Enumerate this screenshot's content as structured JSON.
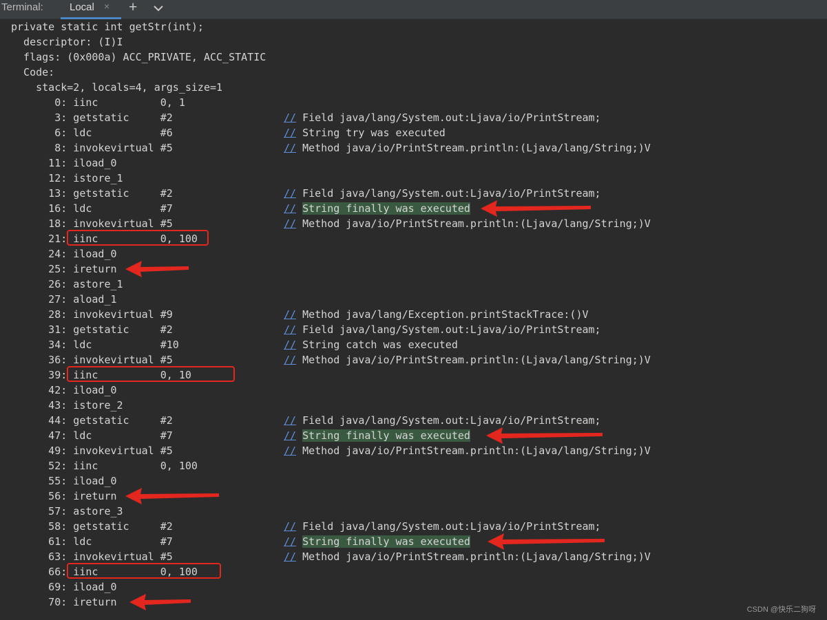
{
  "tabbar": {
    "label": "Terminal:",
    "tab_label": "Local",
    "close_glyph": "×",
    "new_tab_glyph": "+",
    "icons": [
      "close-icon",
      "plus-icon",
      "chevron-down-icon"
    ]
  },
  "header_lines": [
    "private static int getStr(int);",
    "  descriptor: (I)I",
    "  flags: (0x000a) ACC_PRIVATE, ACC_STATIC",
    "  Code:",
    "    stack=2, locals=4, args_size=1"
  ],
  "instructions": [
    {
      "code": "       0: iinc          0, 1",
      "comment": "",
      "highlight": false
    },
    {
      "code": "       3: getstatic     #2",
      "comment": "Field java/lang/System.out:Ljava/io/PrintStream;",
      "highlight": false
    },
    {
      "code": "       6: ldc           #6",
      "comment": "String try was executed",
      "highlight": false
    },
    {
      "code": "       8: invokevirtual #5",
      "comment": "Method java/io/PrintStream.println:(Ljava/lang/String;)V",
      "highlight": false
    },
    {
      "code": "      11: iload_0",
      "comment": "",
      "highlight": false
    },
    {
      "code": "      12: istore_1",
      "comment": "",
      "highlight": false
    },
    {
      "code": "      13: getstatic     #2",
      "comment": "Field java/lang/System.out:Ljava/io/PrintStream;",
      "highlight": false
    },
    {
      "code": "      16: ldc           #7",
      "comment": "String finally was executed",
      "highlight": true
    },
    {
      "code": "      18: invokevirtual #5",
      "comment": "Method java/io/PrintStream.println:(Ljava/lang/String;)V",
      "highlight": false
    },
    {
      "code": "      21: iinc          0, 100",
      "comment": "",
      "highlight": false
    },
    {
      "code": "      24: iload_0",
      "comment": "",
      "highlight": false
    },
    {
      "code": "      25: ireturn",
      "comment": "",
      "highlight": false
    },
    {
      "code": "      26: astore_1",
      "comment": "",
      "highlight": false
    },
    {
      "code": "      27: aload_1",
      "comment": "",
      "highlight": false
    },
    {
      "code": "      28: invokevirtual #9",
      "comment": "Method java/lang/Exception.printStackTrace:()V",
      "highlight": false
    },
    {
      "code": "      31: getstatic     #2",
      "comment": "Field java/lang/System.out:Ljava/io/PrintStream;",
      "highlight": false
    },
    {
      "code": "      34: ldc           #10",
      "comment": "String catch was executed",
      "highlight": false
    },
    {
      "code": "      36: invokevirtual #5",
      "comment": "Method java/io/PrintStream.println:(Ljava/lang/String;)V",
      "highlight": false
    },
    {
      "code": "      39: iinc          0, 10",
      "comment": "",
      "highlight": false
    },
    {
      "code": "      42: iload_0",
      "comment": "",
      "highlight": false
    },
    {
      "code": "      43: istore_2",
      "comment": "",
      "highlight": false
    },
    {
      "code": "      44: getstatic     #2",
      "comment": "Field java/lang/System.out:Ljava/io/PrintStream;",
      "highlight": false
    },
    {
      "code": "      47: ldc           #7",
      "comment": "String finally was executed",
      "highlight": true
    },
    {
      "code": "      49: invokevirtual #5",
      "comment": "Method java/io/PrintStream.println:(Ljava/lang/String;)V",
      "highlight": false
    },
    {
      "code": "      52: iinc          0, 100",
      "comment": "",
      "highlight": false
    },
    {
      "code": "      55: iload_0",
      "comment": "",
      "highlight": false
    },
    {
      "code": "      56: ireturn",
      "comment": "",
      "highlight": false
    },
    {
      "code": "      57: astore_3",
      "comment": "",
      "highlight": false
    },
    {
      "code": "      58: getstatic     #2",
      "comment": "Field java/lang/System.out:Ljava/io/PrintStream;",
      "highlight": false
    },
    {
      "code": "      61: ldc           #7",
      "comment": "String finally was executed",
      "highlight": true
    },
    {
      "code": "      63: invokevirtual #5",
      "comment": "Method java/io/PrintStream.println:(Ljava/lang/String;)V",
      "highlight": false
    },
    {
      "code": "      66: iinc          0, 100",
      "comment": "",
      "highlight": false
    },
    {
      "code": "      69: iload_0",
      "comment": "",
      "highlight": false
    },
    {
      "code": "      70: ireturn",
      "comment": "",
      "highlight": false
    }
  ],
  "comment_prefix": "//",
  "annotations": {
    "boxed_offsets": [
      "21",
      "39",
      "66"
    ],
    "arrow_offsets": [
      "16",
      "25",
      "47",
      "56",
      "61",
      "70"
    ],
    "color": "#e3271f"
  },
  "watermark": "CSDN @快乐二狗呀"
}
